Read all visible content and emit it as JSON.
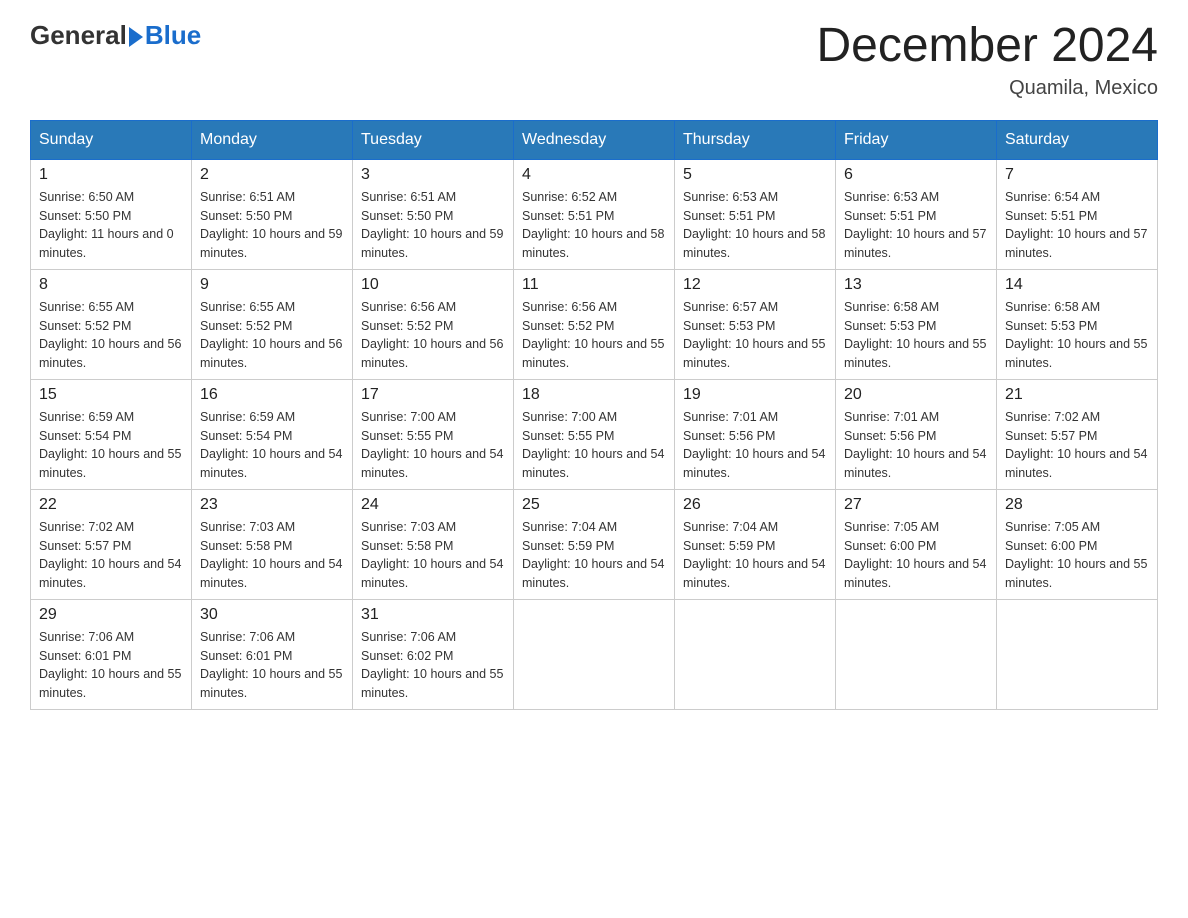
{
  "header": {
    "logo_text_general": "General",
    "logo_text_blue": "Blue",
    "month_title": "December 2024",
    "location": "Quamila, Mexico"
  },
  "calendar": {
    "days_of_week": [
      "Sunday",
      "Monday",
      "Tuesday",
      "Wednesday",
      "Thursday",
      "Friday",
      "Saturday"
    ],
    "weeks": [
      [
        {
          "day": "1",
          "sunrise": "6:50 AM",
          "sunset": "5:50 PM",
          "daylight": "11 hours and 0 minutes."
        },
        {
          "day": "2",
          "sunrise": "6:51 AM",
          "sunset": "5:50 PM",
          "daylight": "10 hours and 59 minutes."
        },
        {
          "day": "3",
          "sunrise": "6:51 AM",
          "sunset": "5:50 PM",
          "daylight": "10 hours and 59 minutes."
        },
        {
          "day": "4",
          "sunrise": "6:52 AM",
          "sunset": "5:51 PM",
          "daylight": "10 hours and 58 minutes."
        },
        {
          "day": "5",
          "sunrise": "6:53 AM",
          "sunset": "5:51 PM",
          "daylight": "10 hours and 58 minutes."
        },
        {
          "day": "6",
          "sunrise": "6:53 AM",
          "sunset": "5:51 PM",
          "daylight": "10 hours and 57 minutes."
        },
        {
          "day": "7",
          "sunrise": "6:54 AM",
          "sunset": "5:51 PM",
          "daylight": "10 hours and 57 minutes."
        }
      ],
      [
        {
          "day": "8",
          "sunrise": "6:55 AM",
          "sunset": "5:52 PM",
          "daylight": "10 hours and 56 minutes."
        },
        {
          "day": "9",
          "sunrise": "6:55 AM",
          "sunset": "5:52 PM",
          "daylight": "10 hours and 56 minutes."
        },
        {
          "day": "10",
          "sunrise": "6:56 AM",
          "sunset": "5:52 PM",
          "daylight": "10 hours and 56 minutes."
        },
        {
          "day": "11",
          "sunrise": "6:56 AM",
          "sunset": "5:52 PM",
          "daylight": "10 hours and 55 minutes."
        },
        {
          "day": "12",
          "sunrise": "6:57 AM",
          "sunset": "5:53 PM",
          "daylight": "10 hours and 55 minutes."
        },
        {
          "day": "13",
          "sunrise": "6:58 AM",
          "sunset": "5:53 PM",
          "daylight": "10 hours and 55 minutes."
        },
        {
          "day": "14",
          "sunrise": "6:58 AM",
          "sunset": "5:53 PM",
          "daylight": "10 hours and 55 minutes."
        }
      ],
      [
        {
          "day": "15",
          "sunrise": "6:59 AM",
          "sunset": "5:54 PM",
          "daylight": "10 hours and 55 minutes."
        },
        {
          "day": "16",
          "sunrise": "6:59 AM",
          "sunset": "5:54 PM",
          "daylight": "10 hours and 54 minutes."
        },
        {
          "day": "17",
          "sunrise": "7:00 AM",
          "sunset": "5:55 PM",
          "daylight": "10 hours and 54 minutes."
        },
        {
          "day": "18",
          "sunrise": "7:00 AM",
          "sunset": "5:55 PM",
          "daylight": "10 hours and 54 minutes."
        },
        {
          "day": "19",
          "sunrise": "7:01 AM",
          "sunset": "5:56 PM",
          "daylight": "10 hours and 54 minutes."
        },
        {
          "day": "20",
          "sunrise": "7:01 AM",
          "sunset": "5:56 PM",
          "daylight": "10 hours and 54 minutes."
        },
        {
          "day": "21",
          "sunrise": "7:02 AM",
          "sunset": "5:57 PM",
          "daylight": "10 hours and 54 minutes."
        }
      ],
      [
        {
          "day": "22",
          "sunrise": "7:02 AM",
          "sunset": "5:57 PM",
          "daylight": "10 hours and 54 minutes."
        },
        {
          "day": "23",
          "sunrise": "7:03 AM",
          "sunset": "5:58 PM",
          "daylight": "10 hours and 54 minutes."
        },
        {
          "day": "24",
          "sunrise": "7:03 AM",
          "sunset": "5:58 PM",
          "daylight": "10 hours and 54 minutes."
        },
        {
          "day": "25",
          "sunrise": "7:04 AM",
          "sunset": "5:59 PM",
          "daylight": "10 hours and 54 minutes."
        },
        {
          "day": "26",
          "sunrise": "7:04 AM",
          "sunset": "5:59 PM",
          "daylight": "10 hours and 54 minutes."
        },
        {
          "day": "27",
          "sunrise": "7:05 AM",
          "sunset": "6:00 PM",
          "daylight": "10 hours and 54 minutes."
        },
        {
          "day": "28",
          "sunrise": "7:05 AM",
          "sunset": "6:00 PM",
          "daylight": "10 hours and 55 minutes."
        }
      ],
      [
        {
          "day": "29",
          "sunrise": "7:06 AM",
          "sunset": "6:01 PM",
          "daylight": "10 hours and 55 minutes."
        },
        {
          "day": "30",
          "sunrise": "7:06 AM",
          "sunset": "6:01 PM",
          "daylight": "10 hours and 55 minutes."
        },
        {
          "day": "31",
          "sunrise": "7:06 AM",
          "sunset": "6:02 PM",
          "daylight": "10 hours and 55 minutes."
        },
        null,
        null,
        null,
        null
      ]
    ]
  }
}
